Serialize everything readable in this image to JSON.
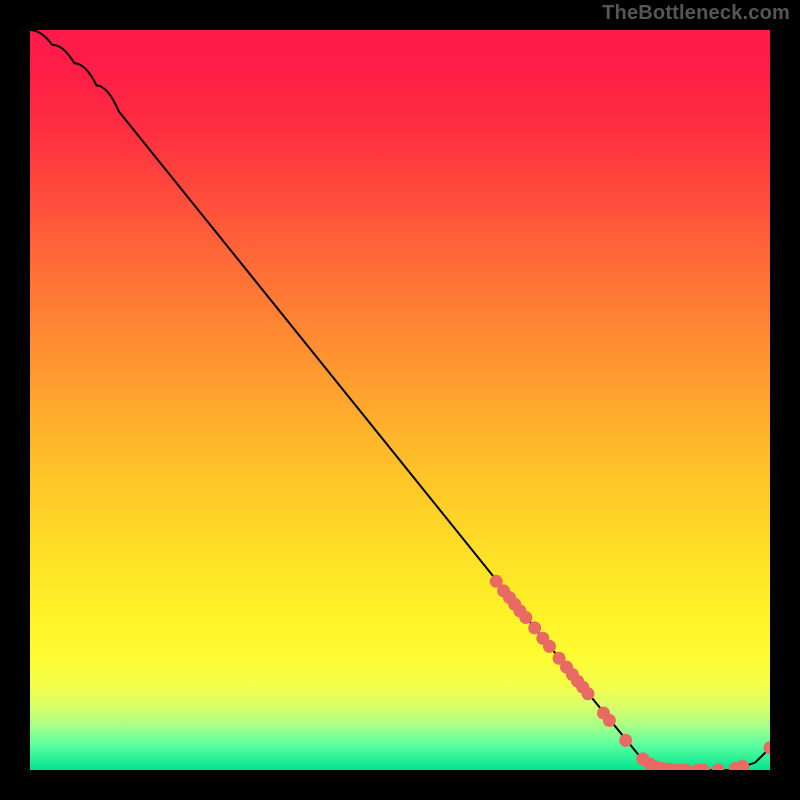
{
  "attribution": "TheBottleneck.com",
  "colors": {
    "background": "#000000",
    "gradient_stops": [
      {
        "offset": 0.0,
        "color": "#ff1a4b"
      },
      {
        "offset": 0.06,
        "color": "#ff1f46"
      },
      {
        "offset": 0.14,
        "color": "#ff3040"
      },
      {
        "offset": 0.22,
        "color": "#ff4a3c"
      },
      {
        "offset": 0.3,
        "color": "#ff6638"
      },
      {
        "offset": 0.38,
        "color": "#ff8034"
      },
      {
        "offset": 0.46,
        "color": "#ff9830"
      },
      {
        "offset": 0.54,
        "color": "#ffb22c"
      },
      {
        "offset": 0.62,
        "color": "#ffc928"
      },
      {
        "offset": 0.7,
        "color": "#ffde26"
      },
      {
        "offset": 0.78,
        "color": "#fff028"
      },
      {
        "offset": 0.84,
        "color": "#fffb30"
      },
      {
        "offset": 0.885,
        "color": "#f5ff4a"
      },
      {
        "offset": 0.915,
        "color": "#d8ff6a"
      },
      {
        "offset": 0.94,
        "color": "#a8ff88"
      },
      {
        "offset": 0.965,
        "color": "#60ffa0"
      },
      {
        "offset": 1.0,
        "color": "#00e58f"
      }
    ],
    "curve": "#000000",
    "marker_fill": "#e86a62",
    "marker_stroke": "#c94f47"
  },
  "chart_data": {
    "type": "line",
    "xlabel": "",
    "ylabel": "",
    "xlim": [
      0,
      100
    ],
    "ylim": [
      0,
      100
    ],
    "grid": false,
    "legend": false,
    "annotations": [
      "TheBottleneck.com"
    ],
    "curve": {
      "name": "bottleneck-curve",
      "points": [
        {
          "x": 0,
          "y": 100
        },
        {
          "x": 3,
          "y": 98
        },
        {
          "x": 6,
          "y": 95.5
        },
        {
          "x": 9,
          "y": 92.5
        },
        {
          "x": 12,
          "y": 89
        },
        {
          "x": 70,
          "y": 17
        },
        {
          "x": 83.5,
          "y": 0.5
        },
        {
          "x": 88,
          "y": 0
        },
        {
          "x": 95,
          "y": 0
        },
        {
          "x": 98,
          "y": 1
        },
        {
          "x": 100,
          "y": 3
        }
      ]
    },
    "markers": [
      {
        "x": 63.0,
        "y": 25.5
      },
      {
        "x": 64.0,
        "y": 24.2
      },
      {
        "x": 64.8,
        "y": 23.3
      },
      {
        "x": 65.5,
        "y": 22.4
      },
      {
        "x": 66.2,
        "y": 21.5
      },
      {
        "x": 67.0,
        "y": 20.6
      },
      {
        "x": 68.2,
        "y": 19.2
      },
      {
        "x": 69.3,
        "y": 17.8
      },
      {
        "x": 70.2,
        "y": 16.7
      },
      {
        "x": 71.5,
        "y": 15.1
      },
      {
        "x": 72.5,
        "y": 13.9
      },
      {
        "x": 73.3,
        "y": 12.9
      },
      {
        "x": 74.0,
        "y": 12.0
      },
      {
        "x": 74.7,
        "y": 11.2
      },
      {
        "x": 75.4,
        "y": 10.3
      },
      {
        "x": 77.5,
        "y": 7.7
      },
      {
        "x": 78.3,
        "y": 6.7
      },
      {
        "x": 80.5,
        "y": 4.0
      },
      {
        "x": 82.8,
        "y": 1.5
      },
      {
        "x": 83.8,
        "y": 0.8
      },
      {
        "x": 84.6,
        "y": 0.4
      },
      {
        "x": 85.4,
        "y": 0.2
      },
      {
        "x": 86.2,
        "y": 0.1
      },
      {
        "x": 87.0,
        "y": 0.0
      },
      {
        "x": 87.8,
        "y": 0.0
      },
      {
        "x": 88.6,
        "y": 0.0
      },
      {
        "x": 90.2,
        "y": 0.0
      },
      {
        "x": 91.0,
        "y": 0.0
      },
      {
        "x": 93.0,
        "y": 0.0
      },
      {
        "x": 95.3,
        "y": 0.2
      },
      {
        "x": 96.3,
        "y": 0.5
      },
      {
        "x": 100.0,
        "y": 3.0
      }
    ]
  }
}
